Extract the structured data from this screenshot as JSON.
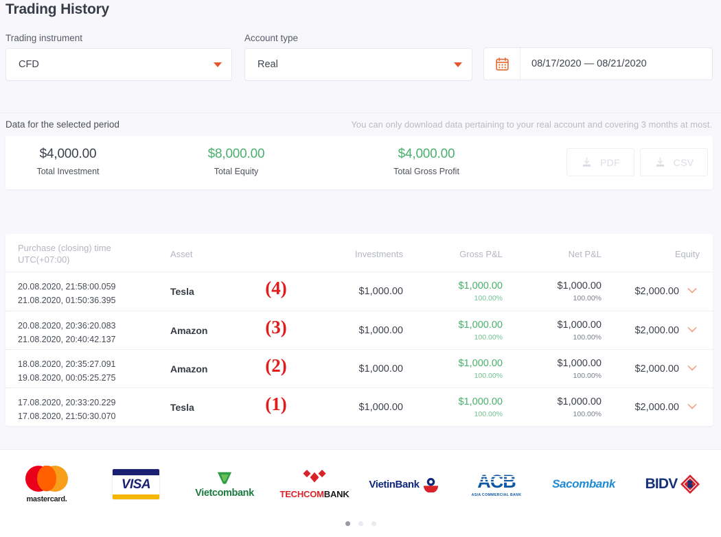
{
  "header": {
    "title": "Trading History"
  },
  "filters": {
    "instrument": {
      "label": "Trading instrument",
      "value": "CFD",
      "caret_icon": "caret-down-icon"
    },
    "account": {
      "label": "Account type",
      "value": "Real",
      "caret_icon": "caret-down-icon"
    },
    "daterange": {
      "calendar_icon": "calendar-icon",
      "value": "08/17/2020 — 08/21/2020"
    }
  },
  "period": {
    "label": "Data for the selected period",
    "note": "You can only download data pertaining to your real account and covering 3 months at most."
  },
  "summary": {
    "stats": [
      {
        "value": "$4,000.00",
        "label": "Total Investment",
        "tone": "dark"
      },
      {
        "value": "$8,000.00",
        "label": "Total Equity",
        "tone": "green"
      },
      {
        "value": "$4,000.00",
        "label": "Total Gross Profit",
        "tone": "green"
      }
    ],
    "downloads": [
      {
        "label": "PDF",
        "icon": "download-icon",
        "disabled": true
      },
      {
        "label": "CSV",
        "icon": "download-icon",
        "disabled": true
      }
    ]
  },
  "table": {
    "columns": {
      "time_line1": "Purchase (closing) time",
      "time_line2": "UTC(+07:00)",
      "asset": "Asset",
      "investments": "Investments",
      "gross": "Gross P&L",
      "net": "Net P&L",
      "equity": "Equity"
    },
    "rows": [
      {
        "open_time": "20.08.2020, 21:58:00.059",
        "close_time": "21.08.2020, 01:50:36.395",
        "asset": "Tesla",
        "marker": "(4)",
        "investments": "$1,000.00",
        "gross": "$1,000.00",
        "gross_pct": "100.00%",
        "net": "$1,000.00",
        "net_pct": "100.00%",
        "equity": "$2,000.00",
        "expand_icon": "chevron-down-icon"
      },
      {
        "open_time": "20.08.2020, 20:36:20.083",
        "close_time": "21.08.2020, 20:40:42.137",
        "asset": "Amazon",
        "marker": "(3)",
        "investments": "$1,000.00",
        "gross": "$1,000.00",
        "gross_pct": "100.00%",
        "net": "$1,000.00",
        "net_pct": "100.00%",
        "equity": "$2,000.00",
        "expand_icon": "chevron-down-icon"
      },
      {
        "open_time": "18.08.2020, 20:35:27.091",
        "close_time": "19.08.2020, 00:05:25.275",
        "asset": "Amazon",
        "marker": "(2)",
        "investments": "$1,000.00",
        "gross": "$1,000.00",
        "gross_pct": "100.00%",
        "net": "$1,000.00",
        "net_pct": "100.00%",
        "equity": "$2,000.00",
        "expand_icon": "chevron-down-icon"
      },
      {
        "open_time": "17.08.2020, 20:33:20.229",
        "close_time": "17.08.2020, 21:50:30.070",
        "asset": "Tesla",
        "marker": "(1)",
        "investments": "$1,000.00",
        "gross": "$1,000.00",
        "gross_pct": "100.00%",
        "net": "$1,000.00",
        "net_pct": "100.00%",
        "equity": "$2,000.00",
        "expand_icon": "chevron-down-icon"
      }
    ]
  },
  "footer": {
    "logos": [
      {
        "name": "mastercard",
        "text": "mastercard."
      },
      {
        "name": "visa",
        "text": "VISA"
      },
      {
        "name": "vietcombank",
        "text": "Vietcombank"
      },
      {
        "name": "techcombank",
        "text_a": "TECHCOM",
        "text_b": "BANK"
      },
      {
        "name": "vietinbank",
        "text": "VietinBank"
      },
      {
        "name": "acb",
        "text": "ACB",
        "sub": "ASIA COMMERCIAL BANK"
      },
      {
        "name": "sacombank",
        "text": "Sacombank"
      },
      {
        "name": "bidv",
        "text": "BIDV"
      }
    ],
    "carousel": {
      "count": 3,
      "active_index": 0
    }
  },
  "colors": {
    "accent": "#e8552c",
    "positive": "#4aaf6e",
    "marker": "#e21b1b",
    "page_bg": "#f8f8fc"
  }
}
